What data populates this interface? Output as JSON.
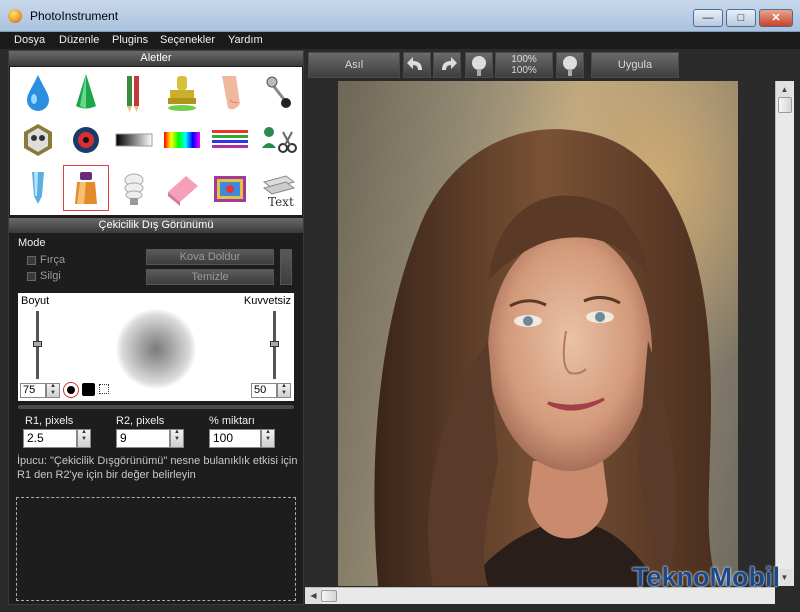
{
  "window": {
    "title": "PhotoInstrument",
    "minimize": "—",
    "maximize": "□",
    "close": "✕"
  },
  "menu": [
    "Dosya",
    "Düzenle",
    "Plugins",
    "Seçenekler",
    "Yardım"
  ],
  "tools_panel": {
    "title": "Aletler"
  },
  "settings_panel": {
    "title": "Çekicilik Dış Görünümü",
    "mode_label": "Mode",
    "brush_label": "Fırça",
    "eraser_label": "Silgi",
    "fill_button": "Kova Doldur",
    "clear_button": "Temizle",
    "size_label": "Boyut",
    "strength_label": "Kuvvetsiz",
    "size_value": "75",
    "strength_value": "50",
    "r1_label": "R1, pixels",
    "r1_value": "2.5",
    "r2_label": "R2, pixels",
    "r2_value": "9",
    "amount_label": "% miktarı",
    "amount_value": "100",
    "hint_line1": "İpucu: \"Çekicilik Dışgörünümü\" nesne bulanıklık etkisi için",
    "hint_line2": "R1 den R2'ye için bir değer belirleyin"
  },
  "toolbar": {
    "original_button": "Asıl",
    "zoom_top": "100%",
    "zoom_bottom": "100%",
    "apply_button": "Uygula"
  },
  "watermark": "TeknoMobil"
}
